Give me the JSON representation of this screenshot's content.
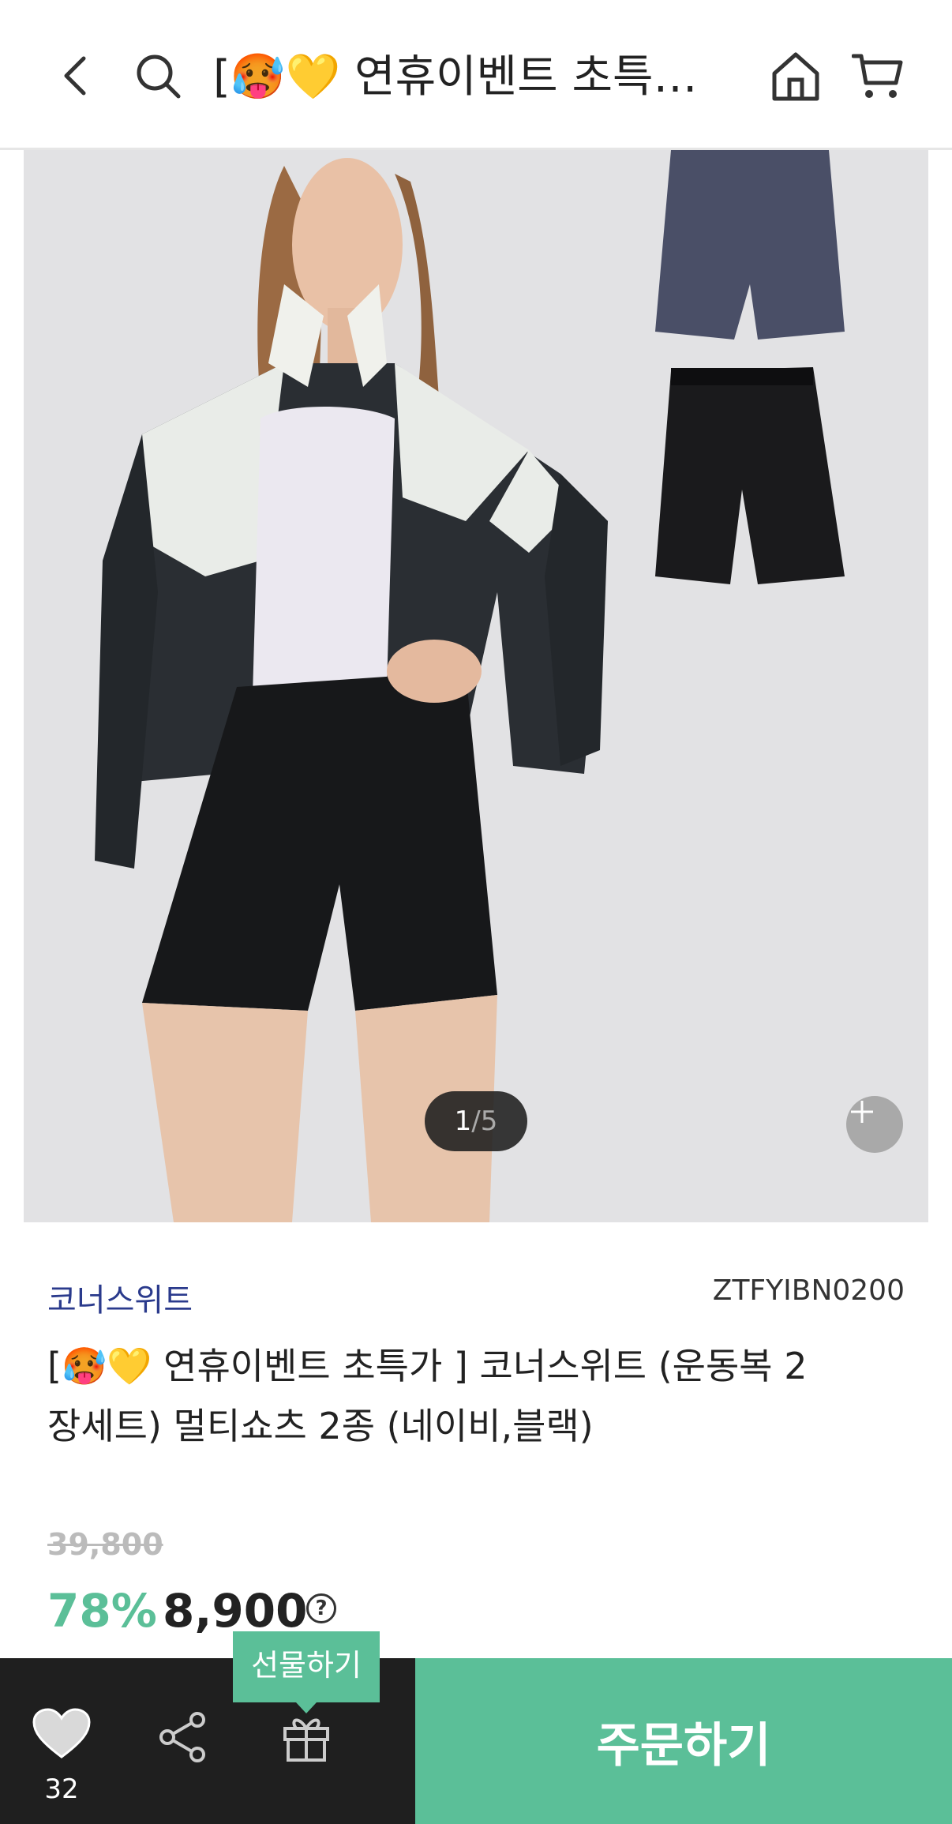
{
  "header": {
    "title": "[🥵💛 연휴이벤트 초특가 ] 코너스위트 (운동복 2장세트) 멀티쇼츠 2종 (네이비,블랙)"
  },
  "gallery": {
    "current": "1",
    "separator": "/",
    "total": "5"
  },
  "product": {
    "brand": "코너스위트",
    "code": "ZTFYIBN0200",
    "title": "[🥵💛 연휴이벤트 초특가 ] 코너스위트 (운동복 2장세트) 멀티쇼츠 2종 (네이비,블랙)",
    "original_price": "39,800",
    "discount": "78%",
    "price": "8,900",
    "help": "?"
  },
  "bottom_bar": {
    "likes": "32",
    "gift_tooltip": "선물하기",
    "order_label": "주문하기"
  },
  "colors": {
    "accent": "#5bbf98",
    "brand_text": "#2a3a8c",
    "bar_dark": "#1f1f1f"
  },
  "icons": [
    "back-icon",
    "search-icon",
    "home-icon",
    "cart-icon",
    "zoom-plus-icon",
    "heart-icon",
    "share-icon",
    "gift-icon"
  ]
}
